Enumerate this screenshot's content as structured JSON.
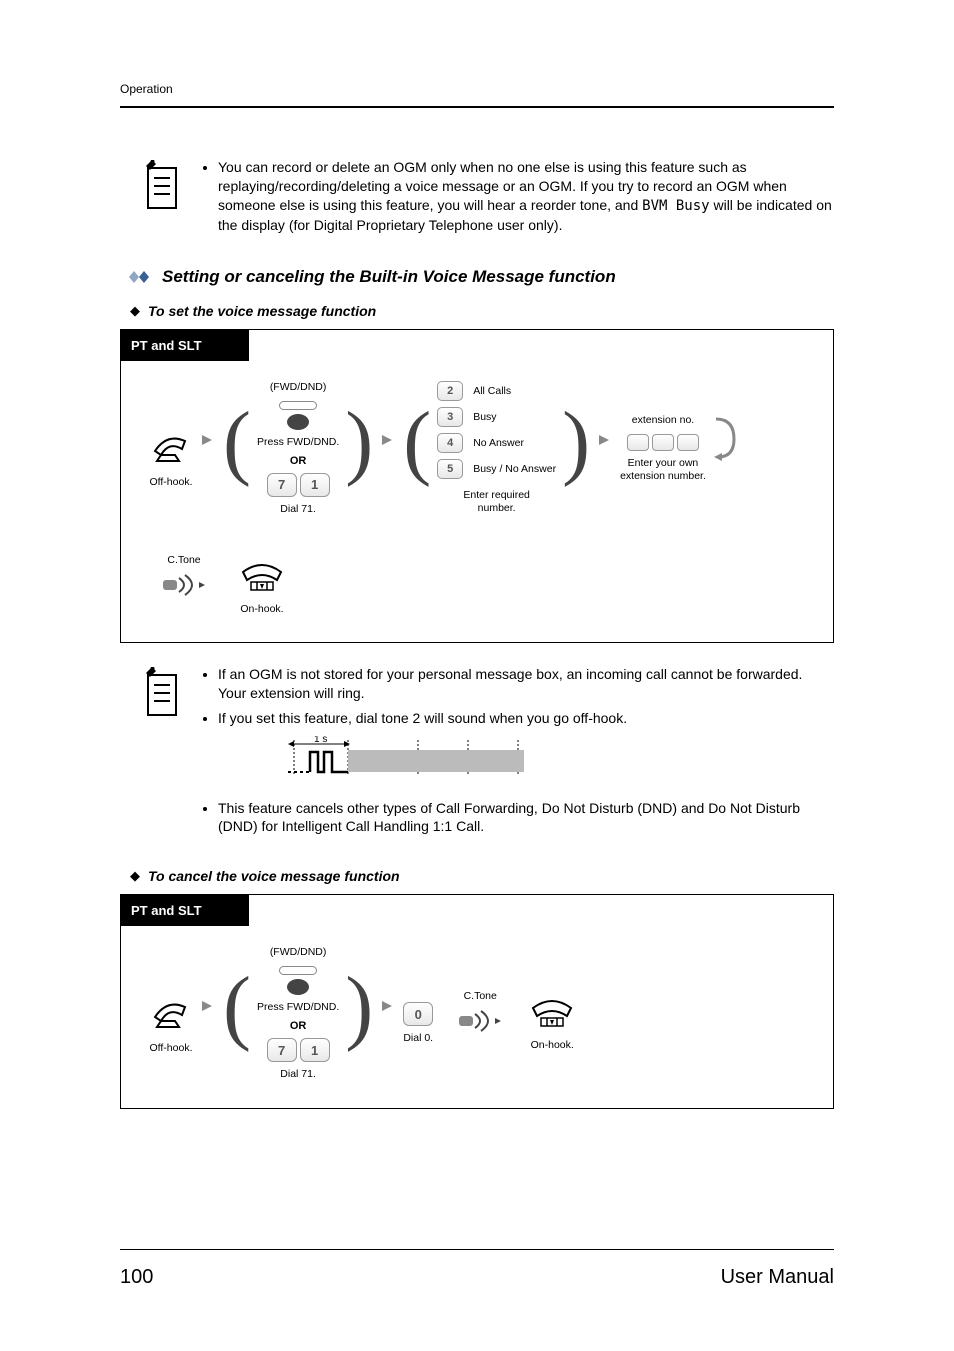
{
  "header": {
    "running": "Operation"
  },
  "note1": {
    "bullet": "You can record or delete an OGM only when no one else is using this feature such as replaying/recording/deleting a voice message or an OGM. If you try to record an OGM when someone else is using this feature, you will hear a reorder tone, and ",
    "bvm_busy": "BVM Busy",
    "bullet_tail": " will be indicated on the display (for Digital Proprietary Telephone user only)."
  },
  "section": {
    "title": "Setting or canceling the Built-in Voice Message function"
  },
  "set": {
    "title": "To set the voice message function",
    "box_label": "PT and SLT",
    "offhook": "Off-hook.",
    "fwd_top": "(FWD/DND)",
    "fwd_press": "Press FWD/DND.",
    "or": "OR",
    "dial71": "Dial 71.",
    "all": "All Calls",
    "busy": "Busy",
    "noans": "No Answer",
    "busy_noans": "Busy / No Answer",
    "enter_req": "Enter required\nnumber.",
    "ext_no": "extension no.",
    "enter_own": "Enter your own\nextension number.",
    "ctone": "C.Tone",
    "onhook": "On-hook.",
    "k2": "2",
    "k3": "3",
    "k4": "4",
    "k5": "5",
    "k7": "7",
    "k1": "1"
  },
  "note2": {
    "bullet1": "If an OGM is not stored for your personal message box, an incoming call cannot be forwarded. Your extension will ring.",
    "bullet2": "If you set this feature, dial tone 2 will sound when you go off-hook.",
    "wave_label": "1 s",
    "bullet3": "This feature cancels other types of Call Forwarding, Do Not Disturb (DND) and Do Not Disturb (DND) for Intelligent Call Handling 1:1 Call."
  },
  "cancel": {
    "title": "To cancel the voice message function",
    "box_label": "PT and SLT",
    "offhook": "Off-hook.",
    "fwd_top": "(FWD/DND)",
    "fwd_press": "Press FWD/DND.",
    "or": "OR",
    "dial71": "Dial 71.",
    "dial0": "Dial 0.",
    "k0": "0",
    "ctone": "C.Tone",
    "onhook": "On-hook.",
    "k7": "7",
    "k1": "1"
  },
  "footer": {
    "page": "100",
    "manual": "User Manual"
  }
}
